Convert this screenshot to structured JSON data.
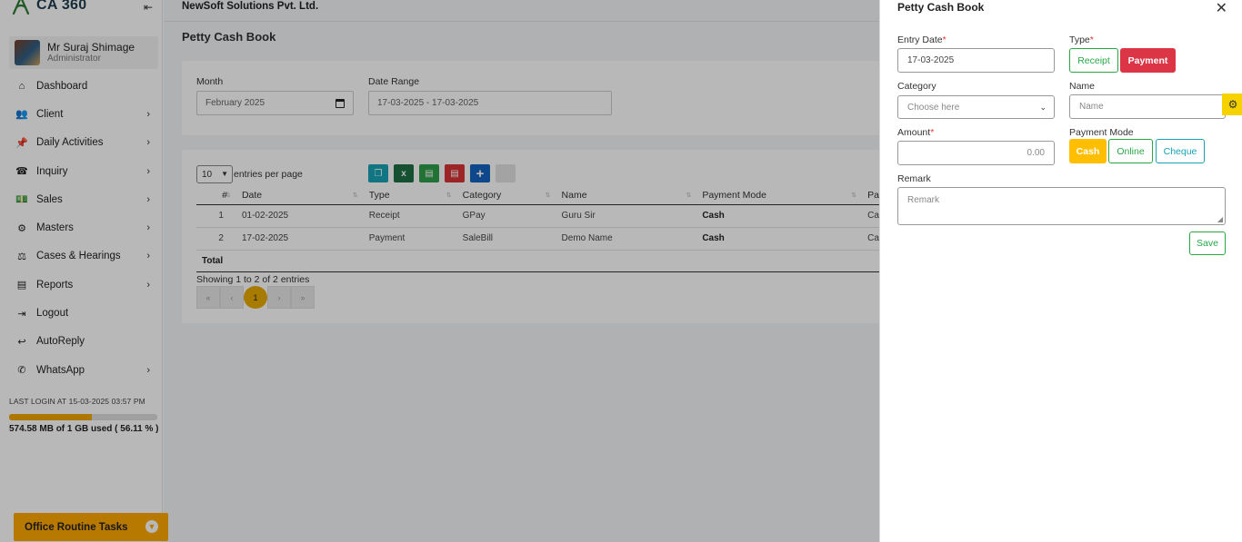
{
  "brand": {
    "name": "CA 360"
  },
  "sidebar": {
    "collapse_icon": "⇤",
    "user": {
      "name": "Mr Suraj Shimage",
      "role": "Administrator"
    },
    "items": [
      {
        "label": "Dashboard",
        "icon": "home-icon",
        "glyph": "⌂",
        "has_sub": false
      },
      {
        "label": "Client",
        "icon": "users-icon",
        "glyph": "👥",
        "has_sub": true
      },
      {
        "label": "Daily Activities",
        "icon": "pin-icon",
        "glyph": "📌",
        "has_sub": true
      },
      {
        "label": "Inquiry",
        "icon": "phone-icon",
        "glyph": "☎",
        "has_sub": true
      },
      {
        "label": "Sales",
        "icon": "money-icon",
        "glyph": "💵",
        "has_sub": true
      },
      {
        "label": "Masters",
        "icon": "cogs-icon",
        "glyph": "⚙",
        "has_sub": true
      },
      {
        "label": "Cases & Hearings",
        "icon": "scale-icon",
        "glyph": "⚖",
        "has_sub": true
      },
      {
        "label": "Reports",
        "icon": "file-icon",
        "glyph": "▤",
        "has_sub": true
      },
      {
        "label": "Logout",
        "icon": "logout-icon",
        "glyph": "⇥",
        "has_sub": false
      },
      {
        "label": "AutoReply",
        "icon": "reply-icon",
        "glyph": "↩",
        "has_sub": false
      },
      {
        "label": "WhatsApp",
        "icon": "whatsapp-icon",
        "glyph": "✆",
        "has_sub": true
      }
    ],
    "last_login": "LAST LOGIN AT 15-03-2025 03:57 PM",
    "storage": {
      "used_fraction": 0.5611,
      "text": "574.58 MB of 1 GB used ( 56.11 % )",
      "color": "#f0a500"
    },
    "routine_label": "Office Routine Tasks"
  },
  "main": {
    "company": "NewSoft Solutions Pvt. Ltd.",
    "page_title": "Petty Cash Book",
    "filters": {
      "month_label": "Month",
      "month_value": "February 2025",
      "range_label": "Date Range",
      "range_value": "17-03-2025 - 17-03-2025"
    },
    "table": {
      "page_length": "10",
      "length_text": "entries per page",
      "columns": [
        "#",
        "Date",
        "Type",
        "Category",
        "Name",
        "Payment Mode",
        "Pa"
      ],
      "rows": [
        {
          "no": "1",
          "date": "01-02-2025",
          "type": "Receipt",
          "category": "GPay",
          "name": "Guru Sir",
          "mode": "Cash",
          "extra": "Ca"
        },
        {
          "no": "2",
          "date": "17-02-2025",
          "type": "Payment",
          "category": "SaleBill",
          "name": "Demo Name",
          "mode": "Cash",
          "extra": "Ca"
        }
      ],
      "total_label": "Total",
      "info": "Showing 1 to 2 of 2 entries",
      "current_page": "1"
    }
  },
  "panel": {
    "title": "Petty Cash Book",
    "entry_date_label": "Entry Date",
    "entry_date_value": "17-03-2025",
    "type_label": "Type",
    "type_options": [
      "Receipt",
      "Payment"
    ],
    "category_label": "Category",
    "category_placeholder": "Choose here",
    "name_label": "Name",
    "name_placeholder": "Name",
    "amount_label": "Amount",
    "amount_placeholder": "0.00",
    "payment_mode_label": "Payment Mode",
    "payment_modes": [
      "Cash",
      "Online",
      "Cheque"
    ],
    "remark_label": "Remark",
    "remark_placeholder": "Remark",
    "save_label": "Save",
    "required_mark": "*"
  },
  "colors": {
    "accent": "#ffa800",
    "payment_red": "#dc3545",
    "receipt_green": "#28a745",
    "cheque_cyan": "#17a2b8",
    "gear_yellow": "#f5d200"
  }
}
